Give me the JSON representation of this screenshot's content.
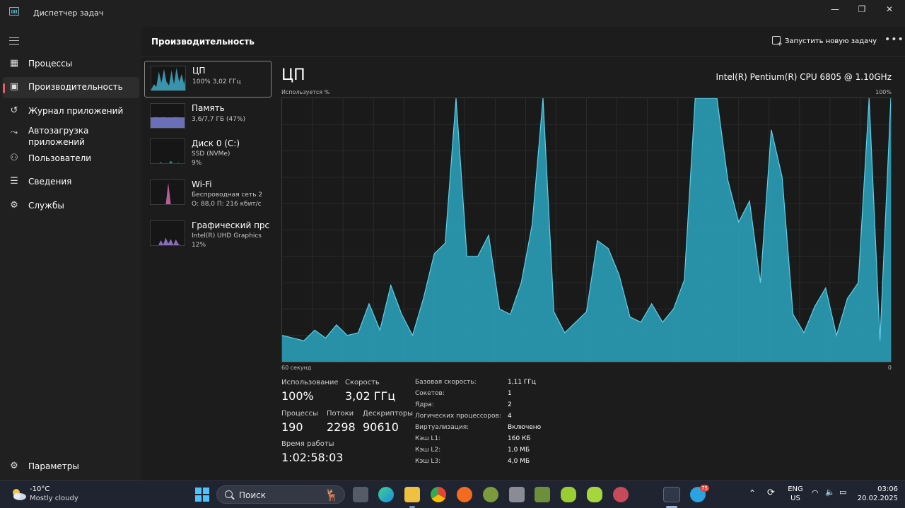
{
  "window": {
    "title": "Диспетчер задач",
    "minimize": "—",
    "maximize": "❐",
    "close": "✕"
  },
  "nav": {
    "items": [
      {
        "label": "Процессы",
        "icon": "processes-icon"
      },
      {
        "label": "Производительность",
        "icon": "performance-icon"
      },
      {
        "label": "Журнал приложений",
        "icon": "app-history-icon"
      },
      {
        "label": "Автозагрузка приложений",
        "icon": "startup-apps-icon"
      },
      {
        "label": "Пользователи",
        "icon": "users-icon"
      },
      {
        "label": "Сведения",
        "icon": "details-icon"
      },
      {
        "label": "Службы",
        "icon": "services-icon"
      }
    ],
    "settings": "Параметры",
    "active_index": 1
  },
  "header": {
    "title": "Производительность",
    "run_task": "Запустить новую задачу",
    "more": "•••"
  },
  "perf_list": [
    {
      "name": "ЦП",
      "sub1": "100%  3,02 ГГц",
      "sub2": "",
      "color": "#3fa9c4"
    },
    {
      "name": "Память",
      "sub1": "3,6/7,7 ГБ (47%)",
      "sub2": "",
      "color": "#7a7fd4"
    },
    {
      "name": "Диск 0 (C:)",
      "sub1": "SSD (NVMe)",
      "sub2": "9%",
      "color": "#3aa89a"
    },
    {
      "name": "Wi-Fi",
      "sub1": "Беспроводная сеть 2",
      "sub2": "О: 88,0  П: 216 кбит/с",
      "color": "#d86ab0"
    },
    {
      "name": "Графический прс",
      "sub1": "Intel(R) UHD Graphics",
      "sub2": "12%",
      "color": "#9b7fd6"
    }
  ],
  "detail": {
    "title": "ЦП",
    "model": "Intel(R) Pentium(R) CPU 6805 @ 1.10GHz",
    "graph_label": "Используется %",
    "graph_max": "100%",
    "graph_time": "60 секунд",
    "graph_min": "0"
  },
  "stats": {
    "usage_label": "Использование",
    "usage_value": "100%",
    "speed_label": "Скорость",
    "speed_value": "3,02 ГГц",
    "processes_label": "Процессы",
    "processes_value": "190",
    "threads_label": "Потоки",
    "threads_value": "2298",
    "handles_label": "Дескрипторы",
    "handles_value": "90610",
    "uptime_label": "Время работы",
    "uptime_value": "1:02:58:03"
  },
  "specs": [
    {
      "label": "Базовая скорость:",
      "value": "1,11 ГГц"
    },
    {
      "label": "Сокетов:",
      "value": "1"
    },
    {
      "label": "Ядра:",
      "value": "2"
    },
    {
      "label": "Логических процессоров:",
      "value": "4"
    },
    {
      "label": "Виртуализация:",
      "value": "Включено"
    },
    {
      "label": "Кэш L1:",
      "value": "160 КБ"
    },
    {
      "label": "Кэш L2:",
      "value": "1,0 МБ"
    },
    {
      "label": "Кэш L3:",
      "value": "4,0 МБ"
    }
  ],
  "chart_data": {
    "type": "area",
    "ylim": [
      0,
      100
    ],
    "values": [
      10,
      9,
      8,
      12,
      9,
      14,
      10,
      11,
      22,
      12,
      29,
      18,
      10,
      24,
      41,
      45,
      100,
      40,
      40,
      48,
      20,
      18,
      30,
      52,
      100,
      19,
      11,
      15,
      19,
      46,
      43,
      33,
      17,
      15,
      22,
      15,
      20,
      31,
      100,
      100,
      100,
      69,
      53,
      61,
      30,
      88,
      70,
      18,
      11,
      21,
      28,
      10,
      24,
      30,
      100,
      8,
      100
    ],
    "color": "#2a9fb8"
  },
  "taskbar": {
    "temp": "-10°C",
    "weather": "Mostly cloudy",
    "search": "Поиск",
    "lang1": "ENG",
    "lang2": "US",
    "time": "03:06",
    "date": "20.02.2025",
    "telegram_badge": "75"
  }
}
